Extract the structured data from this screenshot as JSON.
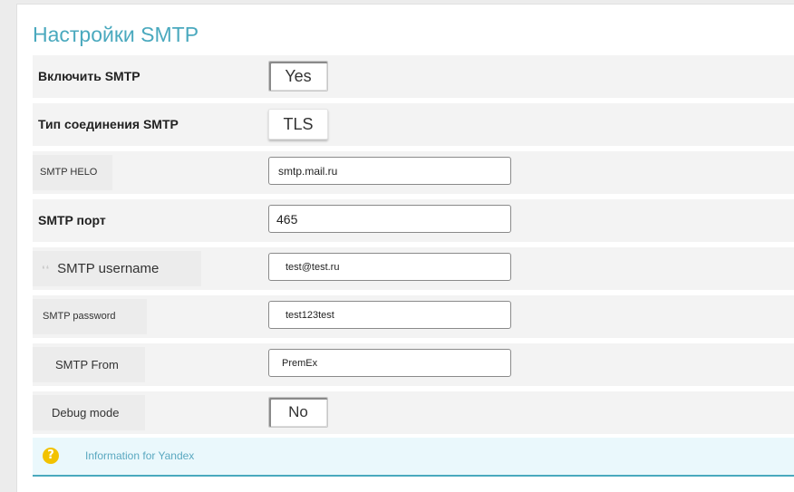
{
  "page": {
    "title": "Настройки SMTP"
  },
  "settings": {
    "enable_smtp": {
      "label": "Включить SMTP",
      "value": "Yes"
    },
    "connection_type": {
      "label": "Тип соединения SMTP",
      "value": "TLS"
    },
    "smtp_helo": {
      "label": "SMTP HELO",
      "value": "smtp.mail.ru"
    },
    "smtp_port": {
      "label": "SMTP порт",
      "value": "465"
    },
    "smtp_username": {
      "label": "SMTP username",
      "value": "test@test.ru",
      "icon": "quote-icon"
    },
    "smtp_password": {
      "label": "SMTP password",
      "value": "test123test"
    },
    "smtp_from": {
      "label": "SMTP From",
      "value": "PremEx"
    },
    "debug_mode": {
      "label": "Debug mode",
      "value": "No"
    }
  },
  "info": {
    "icon": "question-icon",
    "text": "Information for Yandex",
    "accent": "#4aa9be",
    "icon_color": "#f2c200"
  }
}
